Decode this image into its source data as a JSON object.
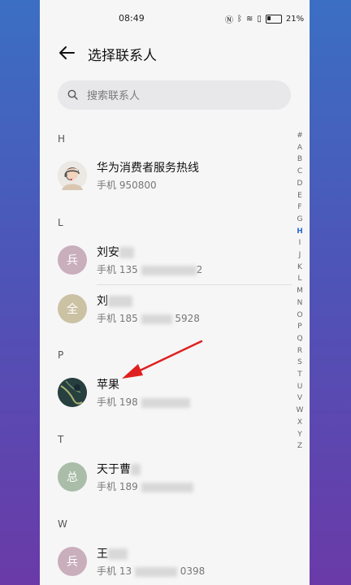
{
  "status_bar": {
    "time": "08:49",
    "battery": "21%"
  },
  "header": {
    "title": "选择联系人"
  },
  "search": {
    "placeholder": "搜索联系人"
  },
  "sections": [
    {
      "letter": "H",
      "contacts": [
        {
          "name": "华为消费者服务热线",
          "phone": "手机 950800"
        }
      ]
    },
    {
      "letter": "L",
      "contacts": [
        {
          "name": "刘安",
          "avatar_char": "兵",
          "avatar_color": "#c9aebc",
          "phone_prefix": "手机 135",
          "phone_suffix": "2"
        },
        {
          "name": "刘",
          "avatar_char": "全",
          "avatar_color": "#cbc2a4",
          "phone_prefix": "手机 185",
          "phone_suffix": "5928"
        }
      ]
    },
    {
      "letter": "P",
      "contacts": [
        {
          "name": "苹果",
          "phone_prefix": "手机 198"
        }
      ]
    },
    {
      "letter": "T",
      "contacts": [
        {
          "name": "天于曹",
          "avatar_char": "总",
          "avatar_color": "#a9bda9",
          "phone_prefix": "手机 189"
        }
      ]
    },
    {
      "letter": "W",
      "contacts": [
        {
          "name": "王",
          "avatar_char": "兵",
          "avatar_color": "#c9aebc",
          "phone_prefix": "手机 13",
          "phone_suffix": "0398"
        }
      ]
    }
  ],
  "alphabet": [
    "#",
    "A",
    "B",
    "C",
    "D",
    "E",
    "F",
    "G",
    "H",
    "I",
    "J",
    "K",
    "L",
    "M",
    "N",
    "O",
    "P",
    "Q",
    "R",
    "S",
    "T",
    "U",
    "V",
    "W",
    "X",
    "Y",
    "Z"
  ],
  "alphabet_active": "H",
  "colors": {
    "accent": "#2b6bd6",
    "annotation_arrow": "#e02020"
  }
}
